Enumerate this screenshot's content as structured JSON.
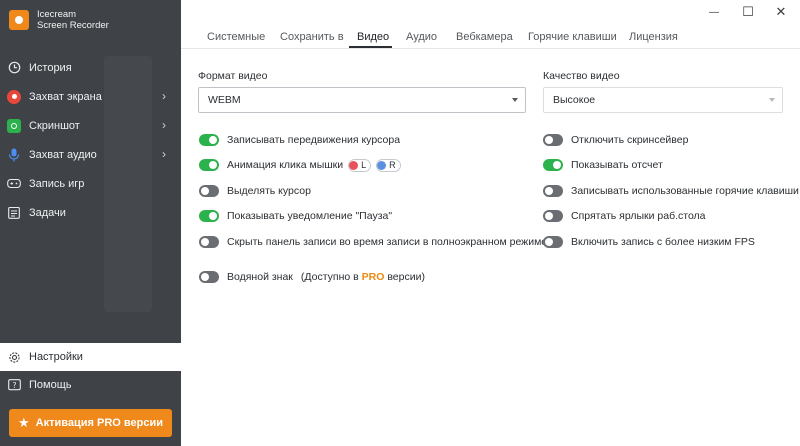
{
  "app": {
    "logo_line1": "Icecream",
    "logo_line2": "Screen Recorder",
    "brand_color": "#f0891c"
  },
  "window_controls": {
    "minimize": "—",
    "maximize": "☐",
    "close": "✕"
  },
  "sidebar": {
    "items": [
      {
        "label": "История",
        "icon": "history-icon"
      },
      {
        "label": "Захват экрана",
        "icon": "record-screen-icon"
      },
      {
        "label": "Скриншот",
        "icon": "camera-icon"
      },
      {
        "label": "Захват аудио",
        "icon": "microphone-icon"
      },
      {
        "label": "Запись игр",
        "icon": "gamepad-icon"
      },
      {
        "label": "Задачи",
        "icon": "tasks-icon"
      }
    ],
    "settings_label": "Настройки",
    "help_label": "Помощь",
    "pro_button_label": "Активация PRO версии"
  },
  "tabs": [
    {
      "label": "Системные"
    },
    {
      "label": "Сохранить в"
    },
    {
      "label": "Видео",
      "active": true
    },
    {
      "label": "Аудио"
    },
    {
      "label": "Вебкамера"
    },
    {
      "label": "Горячие клавиши"
    },
    {
      "label": "Лицензия"
    }
  ],
  "video_format": {
    "label": "Формат видео",
    "value": "WEBM"
  },
  "video_quality": {
    "label": "Качество видео",
    "value": "Высокое"
  },
  "left_options": [
    {
      "label": "Записывать передвижения курсора",
      "on": true
    },
    {
      "label": "Анимация клика мышки",
      "on": true
    },
    {
      "label": "Выделять курсор",
      "on": false
    },
    {
      "label": "Показывать уведомление \"Пауза\"",
      "on": true
    },
    {
      "label": "Скрыть панель записи во время записи в полноэкранном режиме",
      "on": false
    }
  ],
  "mouse_buttons": {
    "left": "L",
    "right": "R",
    "left_color": "#e8525a",
    "right_color": "#5b8fe0"
  },
  "watermark": {
    "label": "Водяной знак",
    "note_prefix": "(Доступно в ",
    "note_pro": "PRO",
    "note_suffix": " версии)",
    "on": false
  },
  "right_options": [
    {
      "label": "Отключить скринсейвер",
      "on": false
    },
    {
      "label": "Показывать отсчет",
      "on": true
    },
    {
      "label": "Записывать использованные горячие клавиши",
      "on": false
    },
    {
      "label": "Спрятать ярлыки раб.стола",
      "on": false
    },
    {
      "label": "Включить запись с более низким FPS",
      "on": false
    }
  ]
}
